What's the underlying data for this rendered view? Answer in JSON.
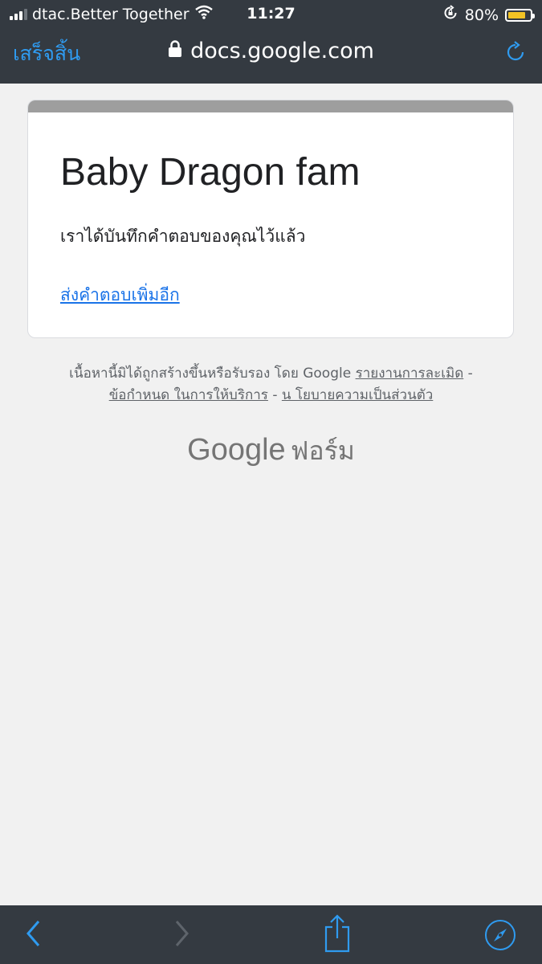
{
  "status_bar": {
    "carrier": "dtac.Better Together",
    "time": "11:27",
    "battery_percent": "80%",
    "battery_level": 0.8,
    "icons": [
      "signal-icon",
      "wifi-icon",
      "rotation-lock-icon",
      "battery-icon"
    ]
  },
  "nav_bar": {
    "done_label": "เสร็จสิ้น",
    "url": "docs.google.com",
    "icons": [
      "lock-icon",
      "reload-icon"
    ]
  },
  "card": {
    "title": "Baby Dragon fam",
    "message": "เราได้บันทึกคำตอบของคุณไว้แล้ว",
    "link_label": "ส่งคำตอบเพิ่มอีก"
  },
  "footer": {
    "disclaimer": "เนื้อหานี้มิได้ถูกสร้างขึ้นหรือรับรอง โดย Google",
    "report_link": "รายงานการละเมิด",
    "terms_link": "ข้อกำหนด ในการให้บริการ",
    "privacy_link": "น โยบายความเป็นส่วนตัว",
    "separator": "-"
  },
  "brand": {
    "google": "Google",
    "forms": "ฟอร์ม"
  },
  "toolbar": {
    "icons": [
      "back-icon",
      "forward-icon",
      "share-icon",
      "compass-icon"
    ]
  },
  "colors": {
    "chrome_bg": "#343a41",
    "accent_blue": "#2f9bf0",
    "link_blue": "#1a73e8",
    "page_bg": "#f1f1f1",
    "battery_yellow": "#f2c324"
  }
}
